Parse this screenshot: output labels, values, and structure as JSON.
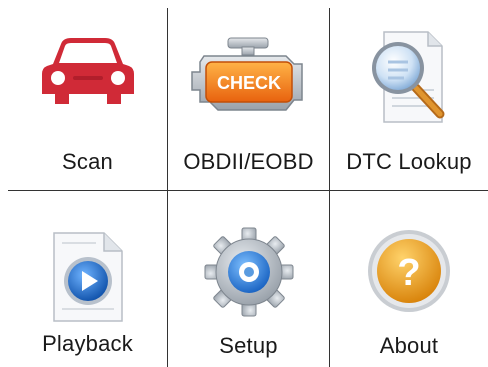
{
  "menu": {
    "items": [
      {
        "id": "scan",
        "label": "Scan",
        "icon": "car-icon"
      },
      {
        "id": "obdii",
        "label": "OBDII/EOBD",
        "icon": "check-engine-icon"
      },
      {
        "id": "dtc",
        "label": "DTC Lookup",
        "icon": "magnifier-document-icon"
      },
      {
        "id": "playback",
        "label": "Playback",
        "icon": "play-document-icon"
      },
      {
        "id": "setup",
        "label": "Setup",
        "icon": "gear-icon"
      },
      {
        "id": "about",
        "label": "About",
        "icon": "question-icon"
      }
    ]
  },
  "colors": {
    "car": "#d02a37",
    "check_engine": "#f07a1c",
    "play": "#1d6fd0",
    "gear": "#9ea7b0",
    "about": "#f2a01a",
    "grid_line": "#333333"
  }
}
